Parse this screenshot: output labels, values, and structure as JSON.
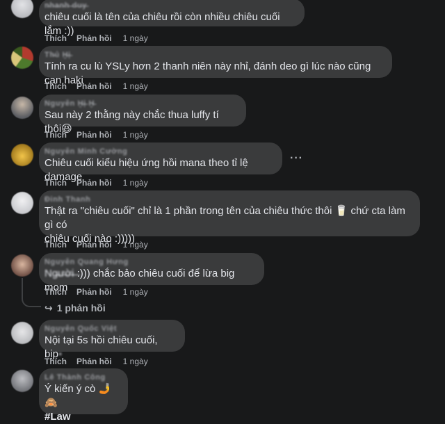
{
  "comments": [
    {
      "author": "n̶h̶a̶n̶h̶ ̶d̶u̶y̶",
      "lines": [
        "chiêu cuối là tên của chiêu rồi còn nhiều chiêu cuối lắm :))"
      ],
      "like": "Thích",
      "reply": "Phản hồi",
      "time": "1 ngày",
      "avatar_color": "#c9cbd0"
    },
    {
      "author": "Th̶ủ Ḫ̶ị̶",
      "lines": [
        "Tính ra cu lù YSLy hơn 2 thanh niên này nhỉ, đánh deo gì lúc nào cũng cạn haki"
      ],
      "like": "Thích",
      "reply": "Phản hồi",
      "time": "1 ngày",
      "avatar_color": "#8a7a3c"
    },
    {
      "author": "Nguyễn Ḫ̶ị̶ Ḫ̶",
      "lines": [
        "Sau này 2 thằng này chắc thua luffy tí thôi😆"
      ],
      "like": "Thích",
      "reply": "Phản hồi",
      "time": "1 ngày",
      "avatar_color": "#8d8f94"
    },
    {
      "author": "Nguyễn Minh Cường",
      "lines": [
        "Chiêu cuối kiểu hiệu ứng hồi mana theo tỉ lệ damage"
      ],
      "like": "Thích",
      "reply": "Phản hồi",
      "time": "1 ngày",
      "avatar_color": "#caa24a",
      "more": "···"
    },
    {
      "author": "Đinh Thanh",
      "lines": [
        "Thật ra \"chiêu cuối\" chỉ là 1 phần trong tên của chiêu thức thôi 🥛  chứ cta làm gì có",
        "chiêu cuối nào :)))))"
      ],
      "like": "Thích",
      "reply": "Phản hồi",
      "time": "1 ngày",
      "avatar_color": "#d8d9dd"
    },
    {
      "author": "Nguyễn Quang Hưng",
      "lines_prefix": "Ng̶ư̶ờ̶i̶ ̶",
      "lines": [
        ":))) chắc bảo chiêu cuối để lừa big mom"
      ],
      "like": "Thích",
      "reply": "Phản hồi",
      "time": "1 ngày",
      "avatar_color": "#a07a68",
      "replies_label": "1 phản hồi"
    },
    {
      "author": "Nguyễn Quốc Việt",
      "lines": [
        "Nội tại 5s hồi chiêu cuối, bịp"
      ],
      "lines_suffix": "▪",
      "like": "Thích",
      "reply": "Phản hồi",
      "time": "1 ngày",
      "avatar_color": "#d5d6da"
    },
    {
      "author": "Lê Thành Công",
      "lines": [
        "Ý kiến ý cò 🤳🙈"
      ],
      "hashtag": "#Law",
      "avatar_color": "#9a9ba0"
    }
  ],
  "icons": {
    "reply_arrow": "reply-arrow-icon"
  },
  "colors": {
    "background": "#18191a",
    "bubble": "#3a3b3c",
    "text": "#e4e6eb",
    "secondary": "#b0b3b8"
  }
}
